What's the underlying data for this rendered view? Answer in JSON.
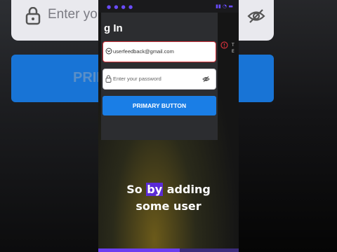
{
  "background": {
    "field_placeholder": "Enter your",
    "button_label": "PRIMA"
  },
  "screen": {
    "title": "g In",
    "email_value": "userfeedback@gmail.com",
    "password_placeholder": "Enter your password",
    "primary_button": "PRIMARY BUTTON",
    "error_text": "T\nE"
  },
  "caption": {
    "line1_before": "So ",
    "line1_highlight": "by",
    "line1_after": " adding",
    "line2": "some user"
  },
  "video_progress": 0.58,
  "colors": {
    "accent": "#1a7ee6",
    "error": "#d0303a",
    "highlight": "#5b2bd6"
  }
}
